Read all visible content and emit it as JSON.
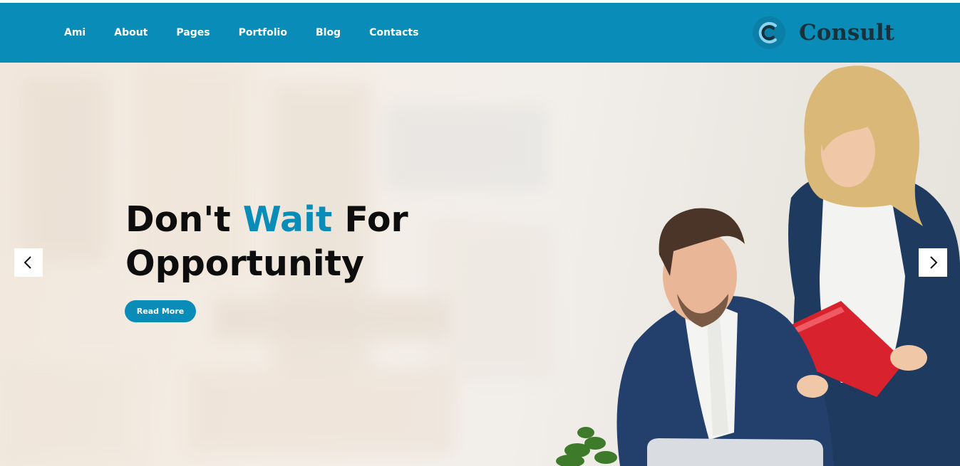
{
  "nav": {
    "items": [
      {
        "label": "Ami"
      },
      {
        "label": "About"
      },
      {
        "label": "Pages"
      },
      {
        "label": "Portfolio"
      },
      {
        "label": "Blog"
      },
      {
        "label": "Contacts"
      }
    ]
  },
  "logo": {
    "text": "Consult",
    "icon": "c-logo-icon"
  },
  "hero": {
    "headline_part1": "Don't",
    "headline_accent": "Wait",
    "headline_part2": "For",
    "headline_line2": "Opportunity",
    "cta_label": "Read More",
    "prev_icon": "chevron-left-icon",
    "next_icon": "chevron-right-icon"
  },
  "colors": {
    "brand": "#0a8cb8",
    "headline": "#0d0d0d",
    "logo_text": "#16323c"
  }
}
